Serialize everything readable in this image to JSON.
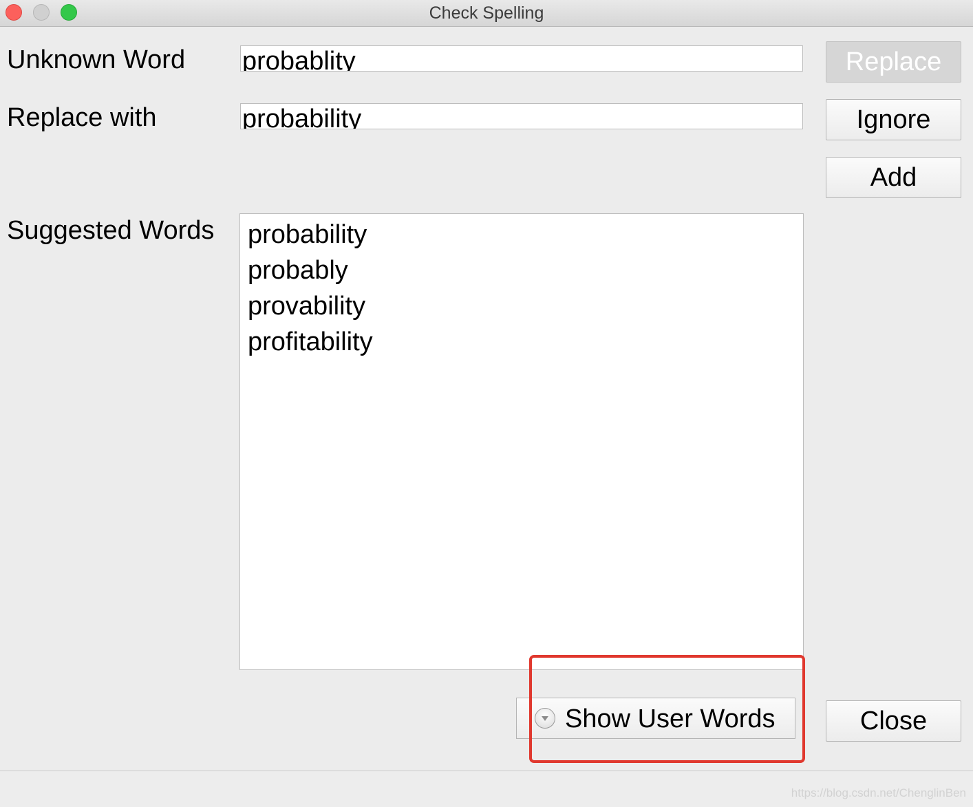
{
  "window": {
    "title": "Check Spelling"
  },
  "form": {
    "unknown_word_label": "Unknown Word",
    "unknown_word_value": "probablity",
    "replace_with_label": "Replace with",
    "replace_with_value": "probability",
    "suggested_words_label": "Suggested Words",
    "suggested_words": [
      "probability",
      "probably",
      "provability",
      "profitability"
    ]
  },
  "buttons": {
    "replace": "Replace",
    "replace_enabled": false,
    "ignore": "Ignore",
    "add": "Add",
    "close": "Close"
  },
  "user_words_toggle": {
    "label": "Show User Words",
    "icon": "disclosure-arrow-down-icon"
  },
  "highlight_color": "#e0382e",
  "watermark": "https://blog.csdn.net/ChenglinBen"
}
